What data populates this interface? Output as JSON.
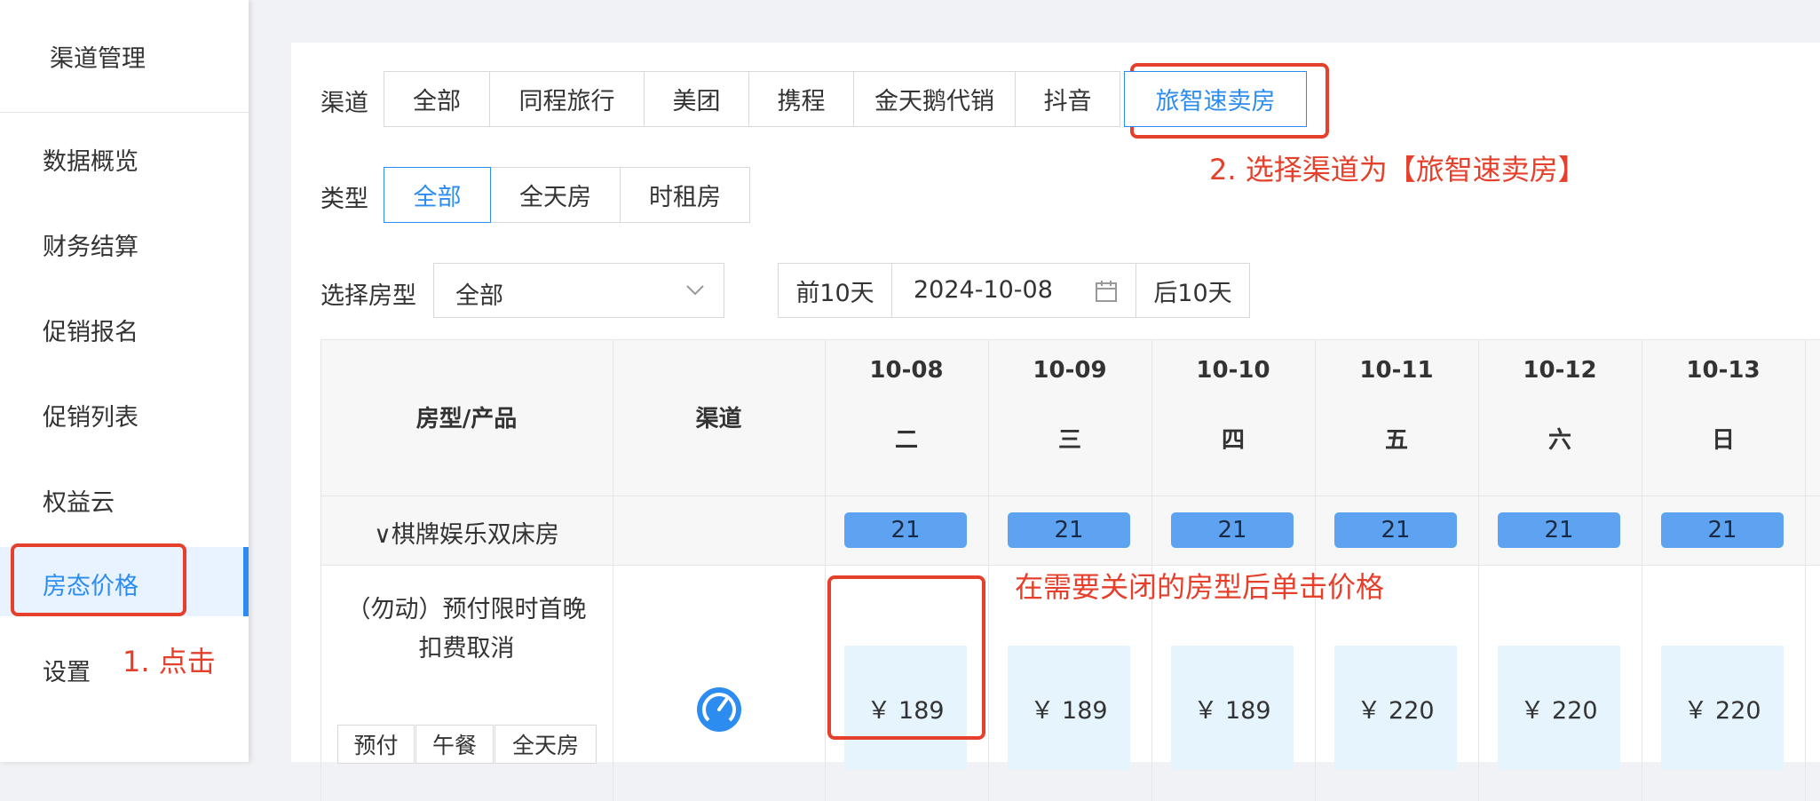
{
  "sidebar": {
    "title": "渠道管理",
    "items": [
      {
        "label": "数据概览"
      },
      {
        "label": "财务结算"
      },
      {
        "label": "促销报名"
      },
      {
        "label": "促销列表"
      },
      {
        "label": "权益云"
      },
      {
        "label": "房态价格",
        "active": true
      },
      {
        "label": "设置"
      }
    ]
  },
  "filters": {
    "channel_label": "渠道",
    "channels": [
      "全部",
      "同程旅行",
      "美团",
      "携程",
      "金天鹅代销",
      "抖音",
      "旅智速卖房"
    ],
    "channel_selected": "旅智速卖房",
    "type_label": "类型",
    "types": [
      "全部",
      "全天房",
      "时租房"
    ],
    "type_selected": "全部",
    "room_type_label": "选择房型",
    "room_type_value": "全部",
    "prev_button": "前10天",
    "date_value": "2024-10-08",
    "next_button": "后10天"
  },
  "table": {
    "col_room": "房型/产品",
    "col_channel": "渠道",
    "dates": [
      {
        "date": "10-08",
        "weekday": "二"
      },
      {
        "date": "10-09",
        "weekday": "三"
      },
      {
        "date": "10-10",
        "weekday": "四"
      },
      {
        "date": "10-11",
        "weekday": "五"
      },
      {
        "date": "10-12",
        "weekday": "六"
      },
      {
        "date": "10-13",
        "weekday": "日"
      }
    ],
    "group": {
      "name": "∨棋牌娱乐双床房",
      "inventory": [
        "21",
        "21",
        "21",
        "21",
        "21",
        "21"
      ]
    },
    "product": {
      "name_line1": "（勿动）预付限时首晚",
      "name_line2": "扣费取消",
      "tags": [
        "预付",
        "午餐",
        "全天房"
      ],
      "channel_icon": "speedometer-icon",
      "prices": [
        "￥ 189",
        "￥ 189",
        "￥ 189",
        "￥ 220",
        "￥ 220",
        "￥ 220"
      ]
    }
  },
  "annotations": {
    "step1": "1. 点击",
    "step2": "2. 选择渠道为【旅智速卖房】",
    "step3": "在需要关闭的房型后单击价格",
    "color": "#e5402c"
  }
}
